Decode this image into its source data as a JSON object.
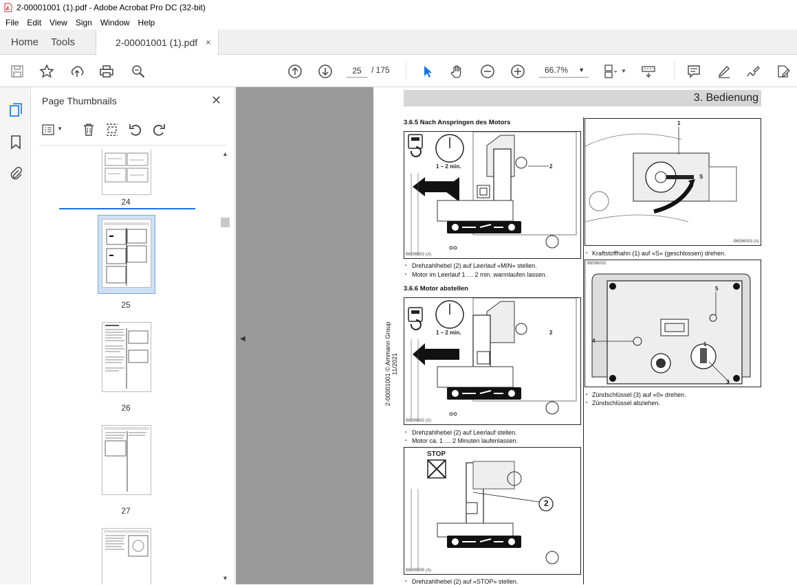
{
  "window": {
    "title": "2-00001001 (1).pdf - Adobe Acrobat Pro DC (32-bit)"
  },
  "menu": [
    "File",
    "Edit",
    "View",
    "Sign",
    "Window",
    "Help"
  ],
  "tabs": {
    "home": "Home",
    "tools": "Tools",
    "document": "2-00001001 (1).pdf",
    "close": "×"
  },
  "toolbar": {
    "page_current": "25",
    "page_total": "/ 175",
    "zoom": "66.7%"
  },
  "thumbnails": {
    "title": "Page Thumbnails",
    "close": "✕",
    "pages": [
      "24",
      "25",
      "26",
      "27"
    ],
    "selected": "25"
  },
  "page": {
    "header": "3. Bedienung",
    "side_text": "2-00001001 © Ammann Group 11/2021",
    "s365_title": "3.6.5     Nach Anspringen des Motors",
    "s365_caption1": "Drehzahlhebel (2) auf Leerlauf «MIN» stellen.",
    "s365_caption2": "Motor im Leerlauf 1 … 2 min. warmlaufen lassen.",
    "s366_title": "3.6.6     Motor abstellen",
    "s366_caption1": "Drehzahlhebel (2) auf Leerlauf stellen.",
    "s366_caption2": "Motor ca. 1 … 2 Minuten laufenlassen.",
    "s366_caption3": "Drehzahlhebel (2) auf «STOP» stellen.",
    "right_caption1": "Kraftstoffhahn (1) auf «S» (geschlossen) drehen.",
    "right_caption2": "Zündschlüssel (3) auf «0» drehen.",
    "right_caption3": "Zündschlüssel abziehen.",
    "fig1": {
      "time": "1 – 2 min.",
      "num": "2",
      "code": "B6599602 (A)"
    },
    "fig2": {
      "time": "1 – 2 min.",
      "num": "2",
      "code": "B6599602 (A)"
    },
    "fig3": {
      "stop": "STOP",
      "num": "2",
      "code": "B6599505 (A)"
    },
    "fig4": {
      "num1": "1",
      "s": "S",
      "code": "B6596003 (A)"
    },
    "fig5": {
      "code": "B6596002",
      "n3": "3",
      "n4": "4",
      "n5": "5",
      "n1": "1"
    }
  }
}
